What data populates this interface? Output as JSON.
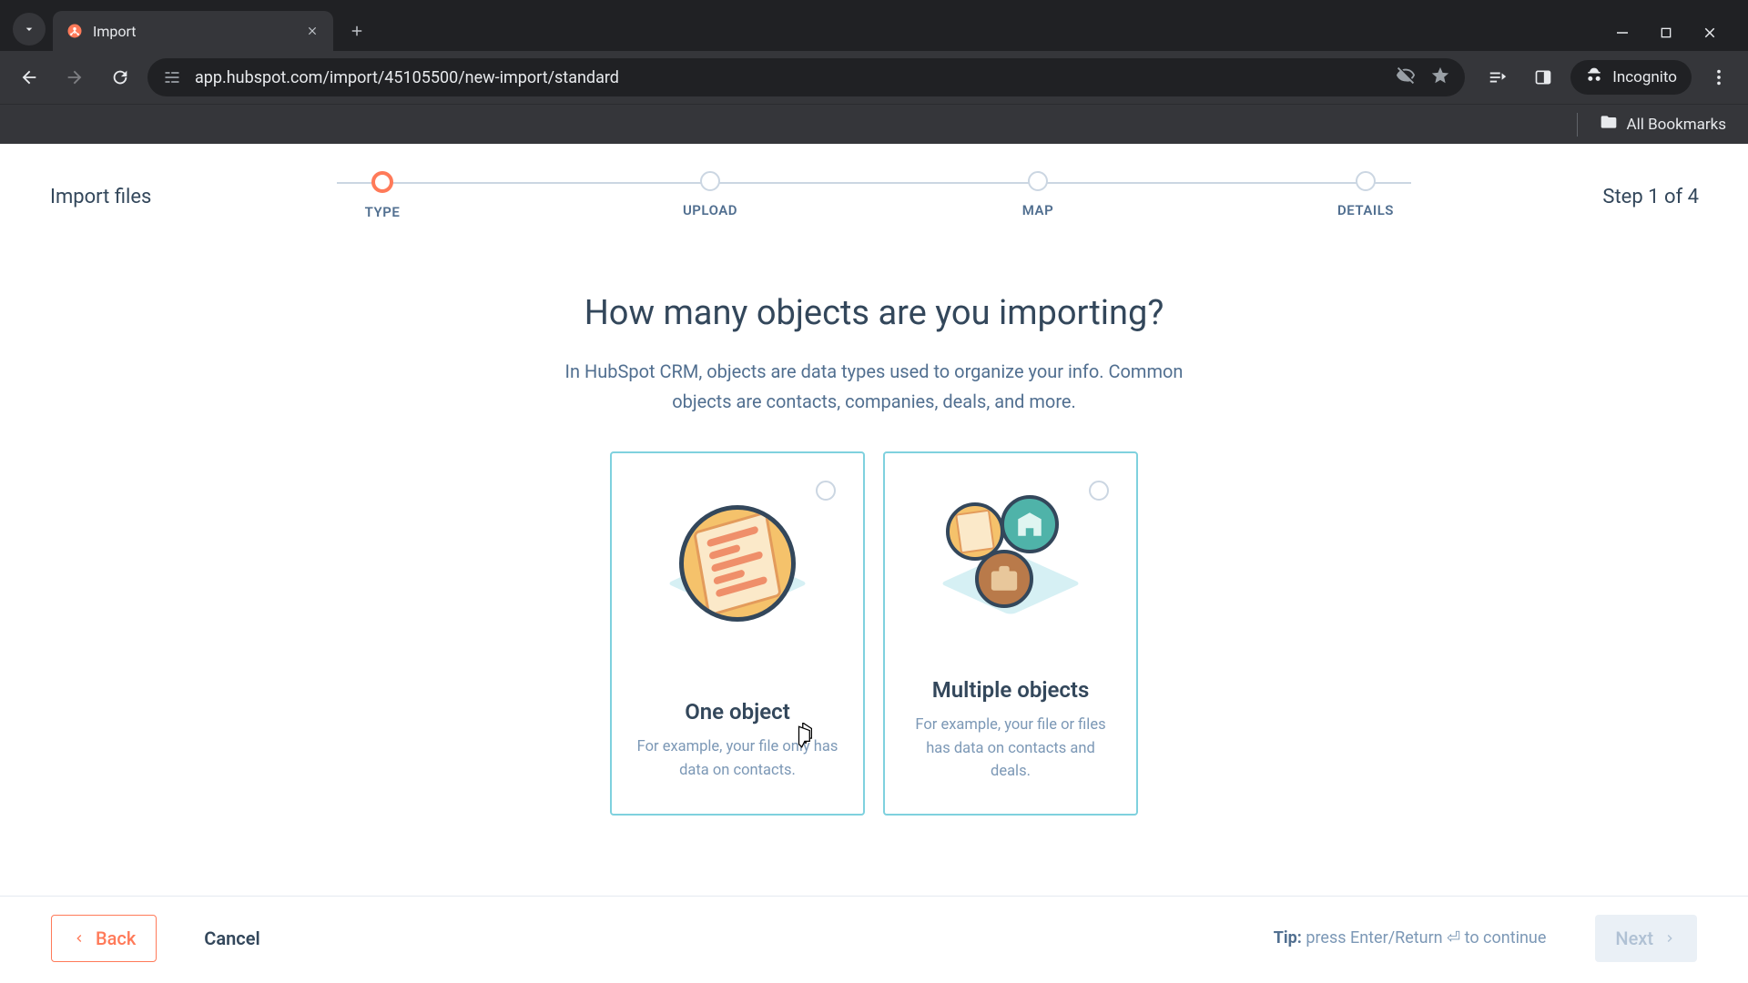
{
  "browser": {
    "tab_title": "Import",
    "url": "app.hubspot.com/import/45105500/new-import/standard",
    "incognito_label": "Incognito",
    "all_bookmarks": "All Bookmarks"
  },
  "wizard": {
    "header_left": "Import files",
    "header_right": "Step 1 of 4",
    "steps": [
      "TYPE",
      "UPLOAD",
      "MAP",
      "DETAILS"
    ],
    "active_step_index": 0
  },
  "content": {
    "question": "How many objects are you importing?",
    "subtext": "In HubSpot CRM, objects are data types used to organize your info. Common objects are contacts, companies, deals, and more.",
    "cards": [
      {
        "title": "One object",
        "desc": "For example, your file only has data on contacts."
      },
      {
        "title": "Multiple objects",
        "desc": "For example, your file or files has data on contacts and deals."
      }
    ]
  },
  "actions": {
    "back": "Back",
    "cancel": "Cancel",
    "tip_bold": "Tip:",
    "tip_rest": " press Enter/Return ⏎ to continue",
    "next": "Next"
  }
}
